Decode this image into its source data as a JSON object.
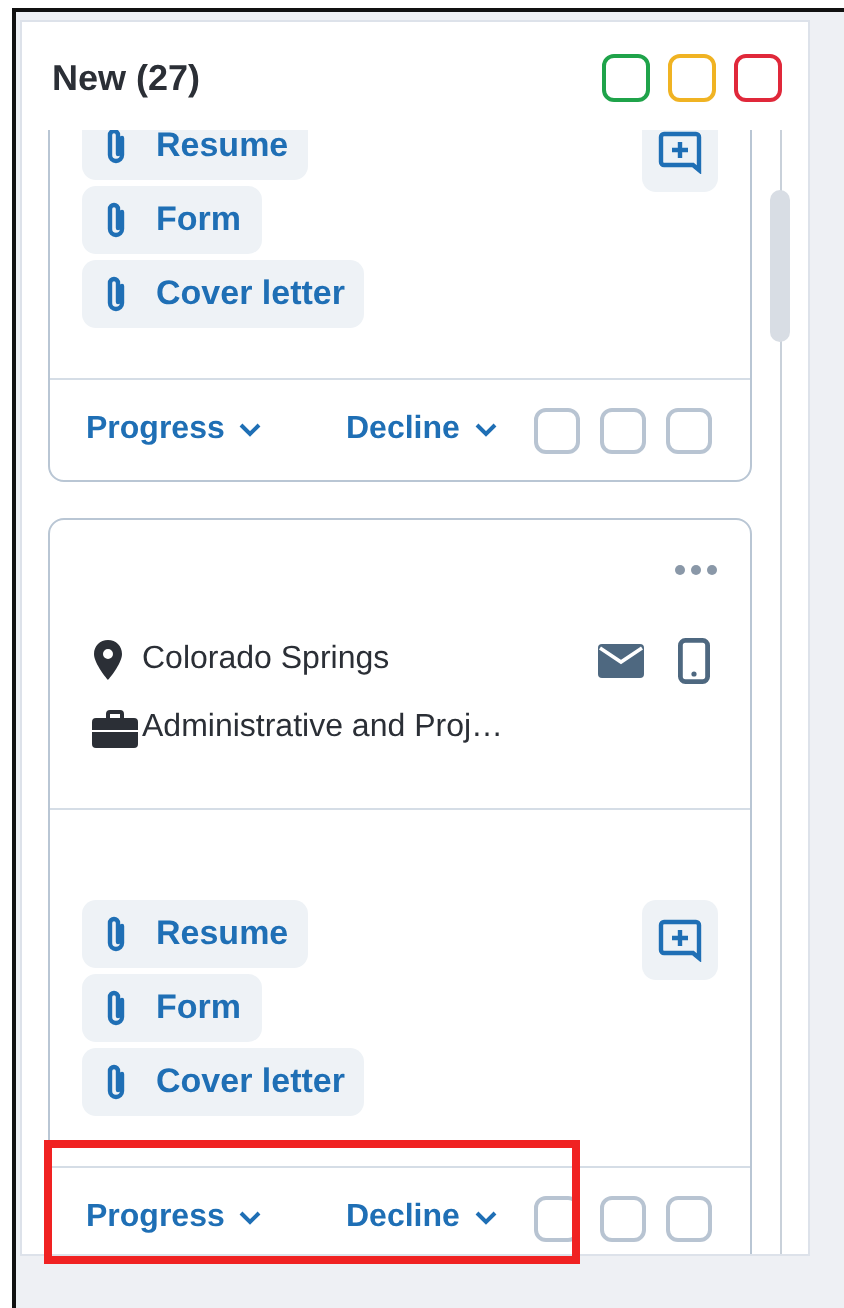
{
  "column": {
    "title": "New (27)",
    "status_boxes": [
      {
        "color": "#1fa34a"
      },
      {
        "color": "#f0b323"
      },
      {
        "color": "#e0283a"
      }
    ]
  },
  "cards": [
    {
      "attachments": [
        "Resume",
        "Form",
        "Cover letter"
      ],
      "actions": [
        "Progress",
        "Decline"
      ],
      "highlighted": false
    },
    {
      "location": "Colorado Springs",
      "job": "Administrative and Proj…",
      "attachments": [
        "Resume",
        "Form",
        "Cover letter"
      ],
      "actions": [
        "Progress",
        "Decline"
      ],
      "highlighted": true
    }
  ]
}
